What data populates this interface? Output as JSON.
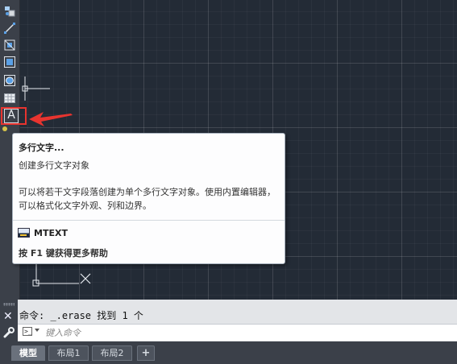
{
  "toolbar": {
    "tools": [
      {
        "icon": "point-style-icon"
      },
      {
        "icon": "line-icon"
      },
      {
        "icon": "region-icon"
      },
      {
        "icon": "rectangle-select-icon"
      },
      {
        "icon": "ellipse-icon"
      },
      {
        "icon": "table-icon"
      },
      {
        "icon": "multiline-text-icon",
        "label": "A",
        "selected": true
      }
    ],
    "highlight_color": "#e8342f"
  },
  "tooltip": {
    "title": "多行文字...",
    "subtitle": "创建多行文字对象",
    "description": "可以将若干文字段落创建为单个多行文字对象。使用内置编辑器，可以格式化文字外观、列和边界。",
    "command": "MTEXT",
    "help": "按 F1 键获得更多帮助"
  },
  "command_line": {
    "history": "命令: _.erase 找到 1 个",
    "placeholder": "键入命令",
    "close_label": "✕"
  },
  "layout_tabs": [
    {
      "label": "模型",
      "active": true
    },
    {
      "label": "布局1",
      "active": false
    },
    {
      "label": "布局2",
      "active": false
    },
    {
      "label": "+",
      "active": false
    }
  ],
  "colors": {
    "canvas": "#232b36",
    "panel": "#3b4049"
  }
}
